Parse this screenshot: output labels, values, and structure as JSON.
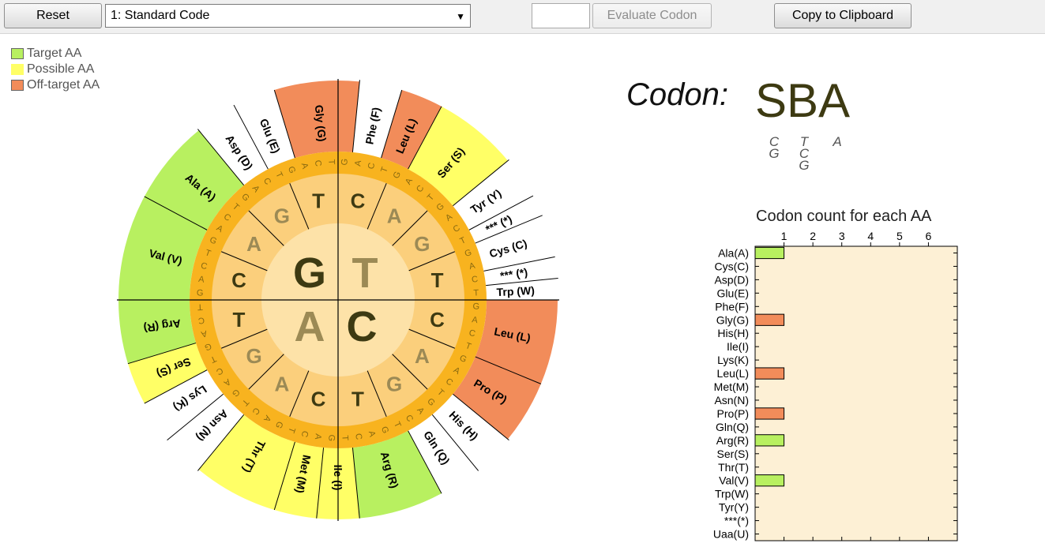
{
  "toolbar": {
    "reset_label": "Reset",
    "code_select_value": "1: Standard Code",
    "codon_input_value": "",
    "evaluate_label": "Evaluate Codon",
    "copy_label": "Copy to Clipboard"
  },
  "legend": [
    {
      "label": "Target AA",
      "color": "#b8f060"
    },
    {
      "label": "Possible AA",
      "color": "#ffff66"
    },
    {
      "label": "Off-target AA",
      "color": "#f28c5a"
    }
  ],
  "codon": {
    "label": "Codon:",
    "value": "SBA",
    "position1": [
      "C",
      "G"
    ],
    "position2": [
      "T",
      "C",
      "G"
    ],
    "position3": [
      "A"
    ]
  },
  "wheel": {
    "inner": [
      "G",
      "T",
      "A",
      "C"
    ],
    "middle": [
      "C",
      "A",
      "G",
      "T",
      "C",
      "A",
      "G",
      "T",
      "C",
      "A",
      "G",
      "T",
      "C",
      "A",
      "G",
      "T"
    ],
    "third": "GACT",
    "aa_sectors": [
      {
        "label": "Val (V)",
        "status": "target"
      },
      {
        "label": "Ala (A)",
        "status": "target"
      },
      {
        "label": "Asp (D)",
        "status": "none"
      },
      {
        "label": "Glu (E)",
        "status": "none"
      },
      {
        "label": "Gly (G)",
        "status": "offtarget"
      },
      {
        "label": "Phe (F)",
        "status": "none"
      },
      {
        "label": "Leu (L)",
        "status": "offtarget"
      },
      {
        "label": "Ser (S)",
        "status": "possible"
      },
      {
        "label": "Tyr (Y)",
        "status": "none"
      },
      {
        "label": "*** (*)",
        "status": "none"
      },
      {
        "label": "Cys (C)",
        "status": "none"
      },
      {
        "label": "*** (*)",
        "status": "none"
      },
      {
        "label": "Trp (W)",
        "status": "none"
      },
      {
        "label": "Leu (L)",
        "status": "offtarget"
      },
      {
        "label": "Pro (P)",
        "status": "offtarget"
      },
      {
        "label": "His (H)",
        "status": "none"
      },
      {
        "label": "Gln (Q)",
        "status": "none"
      },
      {
        "label": "Arg (R)",
        "status": "target"
      },
      {
        "label": "Ile (I)",
        "status": "possible"
      },
      {
        "label": "Met (M)",
        "status": "possible"
      },
      {
        "label": "Thr (T)",
        "status": "possible"
      },
      {
        "label": "Asn (N)",
        "status": "none"
      },
      {
        "label": "Lys (K)",
        "status": "none"
      },
      {
        "label": "Ser (S)",
        "status": "possible"
      },
      {
        "label": "Arg (R)",
        "status": "target"
      }
    ]
  },
  "chart_data": {
    "type": "bar",
    "title": "Codon count for each AA",
    "xlim": [
      0,
      7
    ],
    "xticks": [
      "1",
      "2",
      "3",
      "4",
      "5",
      "6"
    ],
    "categories": [
      "Ala(A)",
      "Cys(C)",
      "Asp(D)",
      "Glu(E)",
      "Phe(F)",
      "Gly(G)",
      "His(H)",
      "Ile(I)",
      "Lys(K)",
      "Leu(L)",
      "Met(M)",
      "Asn(N)",
      "Pro(P)",
      "Gln(Q)",
      "Arg(R)",
      "Ser(S)",
      "Thr(T)",
      "Val(V)",
      "Trp(W)",
      "Tyr(Y)",
      "***(*)",
      "Uaa(U)"
    ],
    "values": [
      1,
      0,
      0,
      0,
      0,
      1,
      0,
      0,
      0,
      1,
      0,
      0,
      1,
      0,
      1,
      0,
      0,
      1,
      0,
      0,
      0,
      0
    ],
    "bar_status": [
      "target",
      "",
      "",
      "",
      "",
      "offtarget",
      "",
      "",
      "",
      "offtarget",
      "",
      "",
      "offtarget",
      "",
      "target",
      "",
      "",
      "target",
      "",
      "",
      "",
      ""
    ],
    "background": "#fdf0d5"
  },
  "colors": {
    "target": "#b8f060",
    "possible": "#ffff66",
    "offtarget": "#f28c5a",
    "inner_disc": "#fde2a8",
    "middle_ring": "#fbcf7c",
    "orange_ring": "#f8b31f"
  }
}
